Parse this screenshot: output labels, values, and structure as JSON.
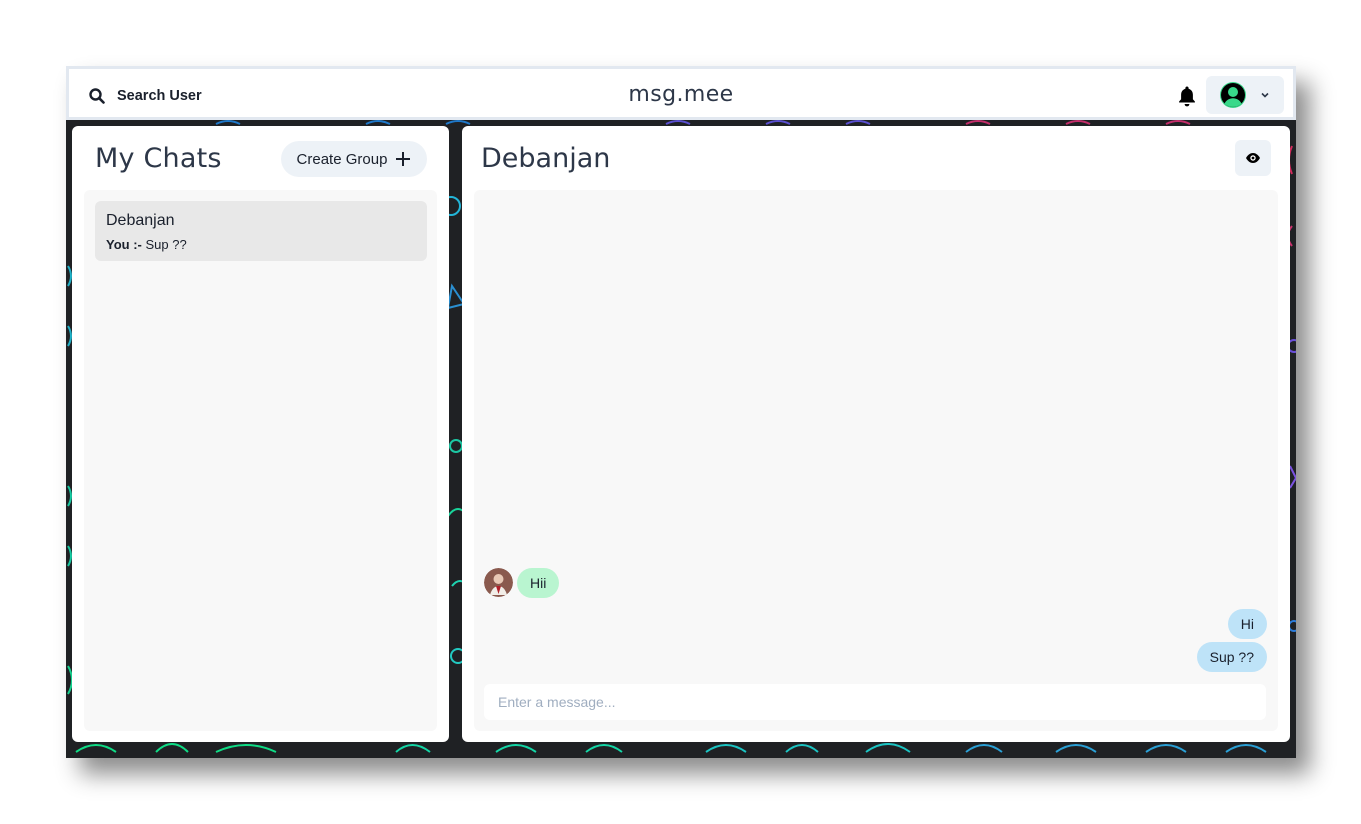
{
  "header": {
    "search_label": "Search User",
    "brand": "msg.mee"
  },
  "sidebar": {
    "title": "My Chats",
    "create_group_label": "Create Group",
    "chats": [
      {
        "name": "Debanjan",
        "sender": "You :-",
        "last_message": "Sup ??"
      }
    ]
  },
  "conversation": {
    "title": "Debanjan",
    "messages": [
      {
        "from": "other",
        "text": "Hii"
      },
      {
        "from": "me",
        "text": "Hi"
      },
      {
        "from": "me",
        "text": "Sup ??"
      }
    ],
    "input_placeholder": "Enter a message..."
  },
  "colors": {
    "incoming_bubble": "#b9f5d0",
    "outgoing_bubble": "#bee3f8",
    "background_dark": "#1f2124"
  }
}
